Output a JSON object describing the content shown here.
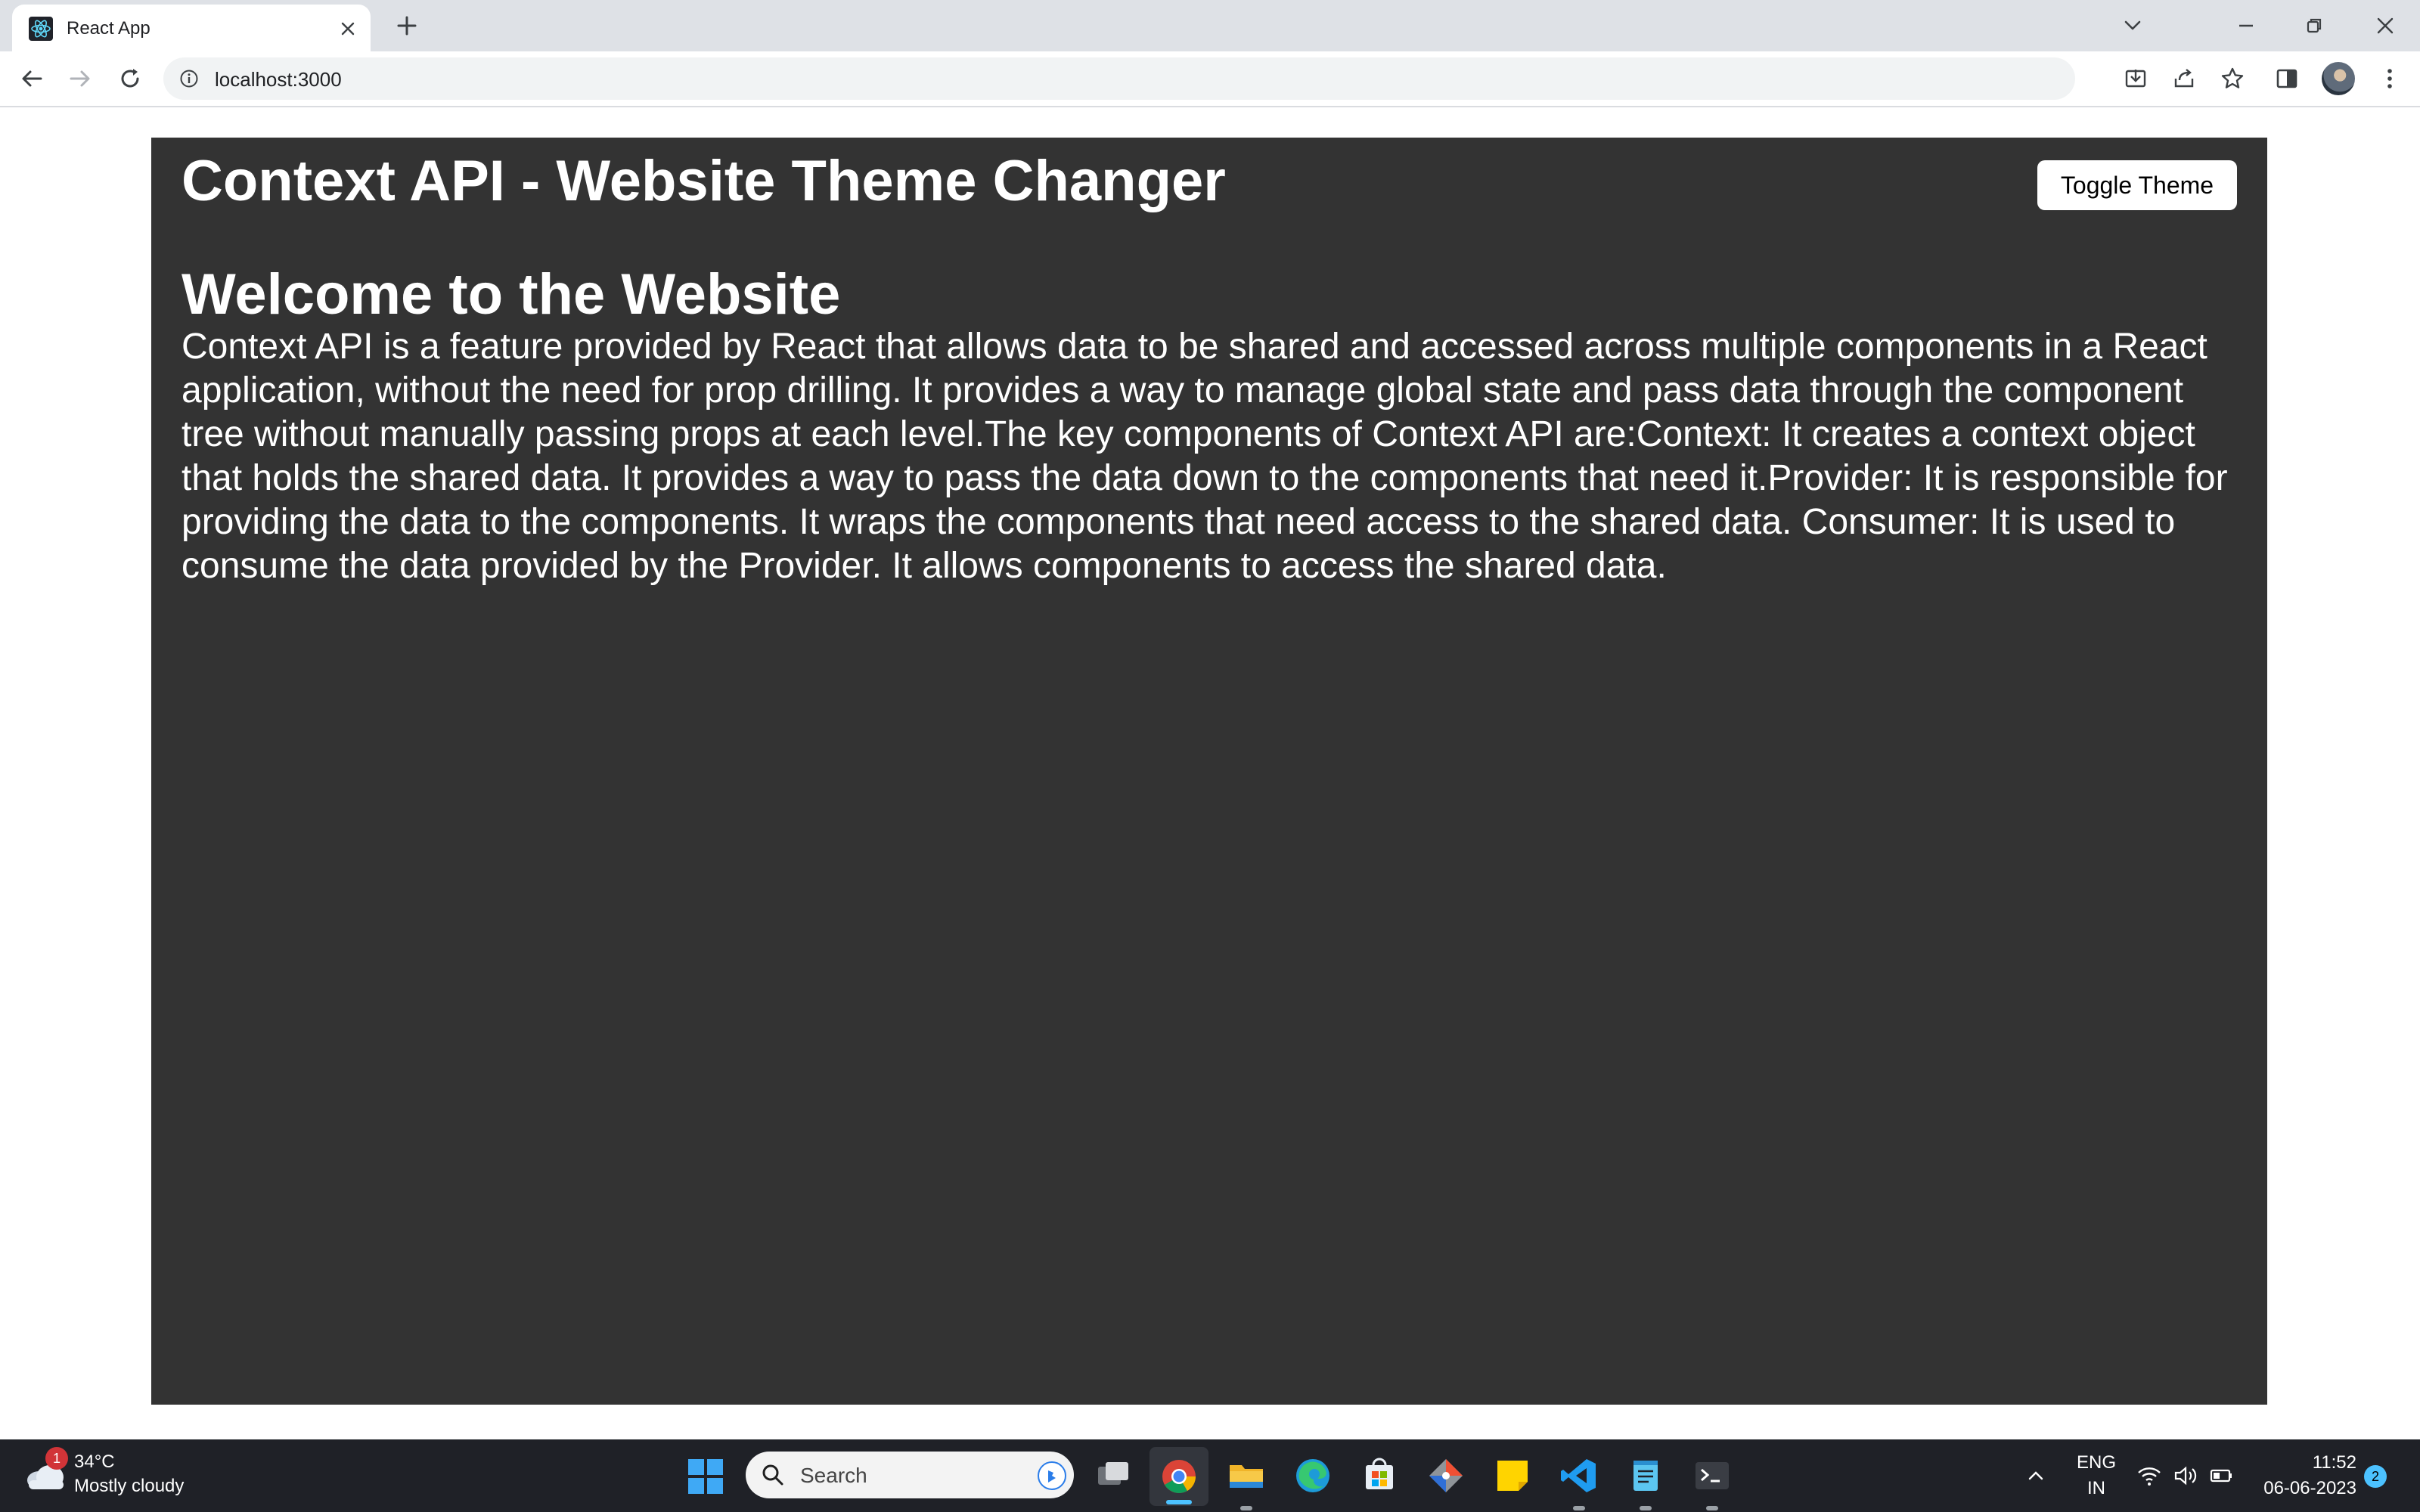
{
  "browser": {
    "tab_title": "React App",
    "url": "localhost:3000"
  },
  "page": {
    "app_title": "Context API - Website Theme Changer",
    "toggle_label": "Toggle Theme",
    "welcome_heading": "Welcome to the Website",
    "paragraph": "Context API is a feature provided by React that allows data to be shared and accessed across multiple components in a React application, without the need for prop drilling. It provides a way to manage global state and pass data through the component tree without manually passing props at each level.The key components of Context API are:Context: It creates a context object that holds the shared data. It provides a way to pass the data down to the components that need it.Provider: It is responsible for providing the data to the components. It wraps the components that need access to the shared data. Consumer: It is used to consume the data provided by the Provider. It allows components to access the shared data.",
    "theme": "dark",
    "colors": {
      "background": "#333333",
      "text": "#ffffff",
      "outer": "#ffffff"
    }
  },
  "taskbar": {
    "weather": {
      "temp": "34°C",
      "desc": "Mostly cloudy",
      "badge": "1"
    },
    "search_placeholder": "Search",
    "apps": [
      "task-view",
      "chrome",
      "file-explorer",
      "edge",
      "microsoft-store",
      "git",
      "sticky-notes",
      "vs-code",
      "notepad",
      "terminal"
    ],
    "lang_line1": "ENG",
    "lang_line2": "IN",
    "time": "11:52",
    "date": "06-06-2023",
    "notifications": "2"
  }
}
